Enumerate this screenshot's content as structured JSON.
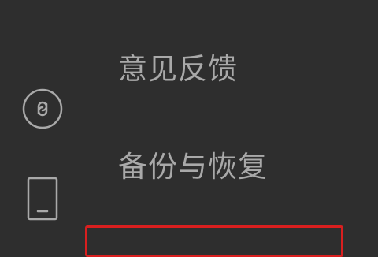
{
  "left_rail": {
    "icons": [
      {
        "name": "mini-program-icon",
        "color": "#a9a9a9"
      },
      {
        "name": "phone-icon",
        "color": "#a9a9a9"
      }
    ]
  },
  "menu": {
    "items": [
      {
        "label": "意见反馈"
      },
      {
        "label": "备份与恢复"
      }
    ]
  },
  "colors": {
    "background": "#2e2e2e",
    "text": "#a9a9a9",
    "highlight": "#d91f1f"
  }
}
